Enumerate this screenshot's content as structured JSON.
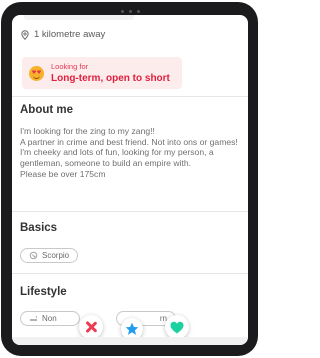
{
  "location": {
    "distance": "1 kilometre away"
  },
  "looking_for": {
    "label": "Looking for",
    "value": "Long-term, open to short"
  },
  "about": {
    "heading": "About me",
    "text": "I'm looking for the zing to my zang!!\nA partner in crime and best friend.  Not into ons or games! I'm cheeky and lots of fun, looking for my person, a gentleman, someone to build an empire with.\nPlease be over 175cm"
  },
  "basics": {
    "heading": "Basics",
    "items": [
      {
        "icon": "scorpio-icon",
        "label": "Scorpio"
      }
    ]
  },
  "lifestyle": {
    "heading": "Lifestyle",
    "items": [
      {
        "icon": "smoking-icon",
        "label": "Non"
      },
      {
        "icon": "pet-icon",
        "label": "rn"
      }
    ]
  },
  "actions": {
    "nope": "nope",
    "super_like": "super-like",
    "like": "like"
  },
  "colors": {
    "brand": "#e0203f",
    "nope": "#ee3b52",
    "super_like": "#1e9cf0",
    "like": "#1bd1a0"
  }
}
